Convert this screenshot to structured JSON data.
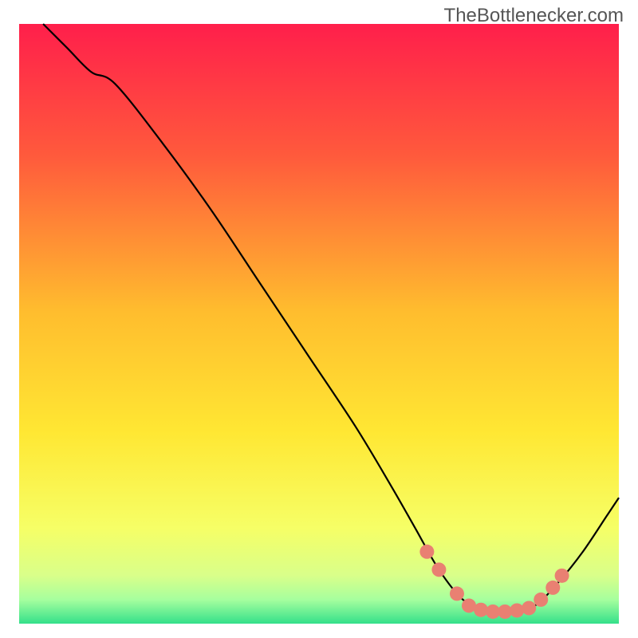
{
  "watermark": "TheBottlenecker.com",
  "chart_data": {
    "type": "line",
    "title": "",
    "xlabel": "",
    "ylabel": "",
    "xlim": [
      0,
      100
    ],
    "ylim": [
      0,
      100
    ],
    "grid": false,
    "gradient_axis": "y",
    "gradient_stops": [
      {
        "offset": 0,
        "color": "#ff1f4b"
      },
      {
        "offset": 22,
        "color": "#ff5a3c"
      },
      {
        "offset": 48,
        "color": "#ffbd2e"
      },
      {
        "offset": 68,
        "color": "#ffe733"
      },
      {
        "offset": 84,
        "color": "#f6ff66"
      },
      {
        "offset": 92,
        "color": "#d9ff8a"
      },
      {
        "offset": 96,
        "color": "#a6ff9e"
      },
      {
        "offset": 100,
        "color": "#34e08a"
      }
    ],
    "series": [
      {
        "name": "bottleneck-curve",
        "description": "Black curve: y decreases roughly linearly from top-left, flattens near bottom around x≈75-85, then rises toward the right edge.",
        "points": [
          {
            "x": 4,
            "y": 100
          },
          {
            "x": 8,
            "y": 96
          },
          {
            "x": 12,
            "y": 92
          },
          {
            "x": 16,
            "y": 90
          },
          {
            "x": 24,
            "y": 80
          },
          {
            "x": 32,
            "y": 69
          },
          {
            "x": 40,
            "y": 57
          },
          {
            "x": 48,
            "y": 45
          },
          {
            "x": 56,
            "y": 33
          },
          {
            "x": 62,
            "y": 23
          },
          {
            "x": 66,
            "y": 16
          },
          {
            "x": 70,
            "y": 9
          },
          {
            "x": 74,
            "y": 4
          },
          {
            "x": 78,
            "y": 2
          },
          {
            "x": 82,
            "y": 2
          },
          {
            "x": 86,
            "y": 3
          },
          {
            "x": 90,
            "y": 7
          },
          {
            "x": 94,
            "y": 12
          },
          {
            "x": 98,
            "y": 18
          },
          {
            "x": 100,
            "y": 21
          }
        ]
      }
    ],
    "markers": {
      "name": "highlighted-range-dots",
      "color": "#e98072",
      "radius_px": 9,
      "description": "Salmon dots along the curve near its minimum; cluster densely between x≈72 and x≈90.",
      "points": [
        {
          "x": 68,
          "y": 12
        },
        {
          "x": 70,
          "y": 9
        },
        {
          "x": 73,
          "y": 5
        },
        {
          "x": 75,
          "y": 3
        },
        {
          "x": 77,
          "y": 2.3
        },
        {
          "x": 79,
          "y": 2
        },
        {
          "x": 81,
          "y": 2
        },
        {
          "x": 83,
          "y": 2.2
        },
        {
          "x": 85,
          "y": 2.6
        },
        {
          "x": 87,
          "y": 4
        },
        {
          "x": 89,
          "y": 6
        },
        {
          "x": 90.5,
          "y": 8
        }
      ]
    }
  }
}
